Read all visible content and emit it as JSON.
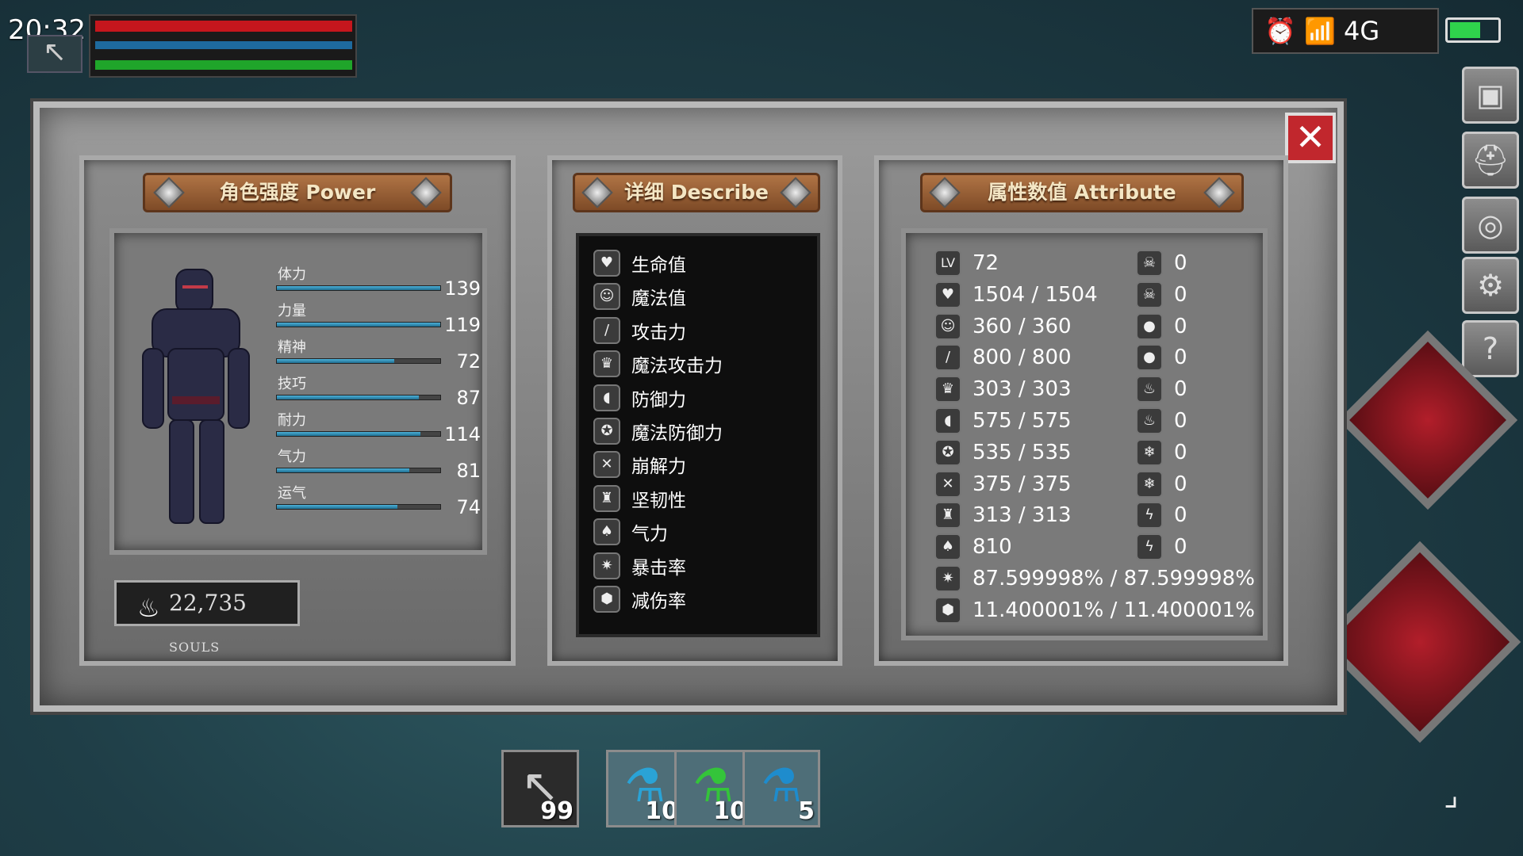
{
  "hud": {
    "time": "20:32",
    "status_text": "⏰ 📶 4G"
  },
  "panel": {
    "power_title": "角色强度 Power",
    "describe_title": "详细 Describe",
    "attribute_title": "属性数值 Attribute"
  },
  "power": {
    "stats": [
      {
        "label": "体力",
        "value": "139",
        "fill": 1.0
      },
      {
        "label": "力量",
        "value": "119",
        "fill": 1.0
      },
      {
        "label": "精神",
        "value": "72",
        "fill": 0.72
      },
      {
        "label": "技巧",
        "value": "87",
        "fill": 0.87
      },
      {
        "label": "耐力",
        "value": "114",
        "fill": 0.88
      },
      {
        "label": "气力",
        "value": "81",
        "fill": 0.81
      },
      {
        "label": "运气",
        "value": "74",
        "fill": 0.74
      }
    ],
    "souls_amount": "22,735",
    "souls_unit": "SOULS"
  },
  "describe": {
    "items": [
      {
        "label": "生命值",
        "icon": "heart-icon"
      },
      {
        "label": "魔法值",
        "icon": "mind-icon"
      },
      {
        "label": "攻击力",
        "icon": "sword-icon"
      },
      {
        "label": "魔法攻击力",
        "icon": "magic-attack-icon"
      },
      {
        "label": "防御力",
        "icon": "shield-icon"
      },
      {
        "label": "魔法防御力",
        "icon": "magic-defense-icon"
      },
      {
        "label": "崩解力",
        "icon": "break-icon"
      },
      {
        "label": "坚韧性",
        "icon": "helmet-icon"
      },
      {
        "label": "气力",
        "icon": "lungs-icon"
      },
      {
        "label": "暴击率",
        "icon": "crit-icon"
      },
      {
        "label": "减伤率",
        "icon": "damage-reduction-icon"
      }
    ]
  },
  "attributes": {
    "left": [
      {
        "icon": "level-icon",
        "value": "72"
      },
      {
        "icon": "heart-icon",
        "value": "1504 / 1504"
      },
      {
        "icon": "mind-icon",
        "value": "360 / 360"
      },
      {
        "icon": "sword-icon",
        "value": "800 / 800"
      },
      {
        "icon": "magic-attack-icon",
        "value": "303 / 303"
      },
      {
        "icon": "shield-icon",
        "value": "575 / 575"
      },
      {
        "icon": "magic-defense-icon",
        "value": "535 / 535"
      },
      {
        "icon": "break-icon",
        "value": "375 / 375"
      },
      {
        "icon": "helmet-icon",
        "value": "313 / 313"
      },
      {
        "icon": "lungs-icon",
        "value": "810"
      },
      {
        "icon": "crit-icon",
        "value": "87.599998% / 87.599998%"
      },
      {
        "icon": "damage-reduction-icon",
        "value": "11.400001% / 11.400001%"
      }
    ],
    "right": [
      {
        "icon": "poison-icon",
        "value": "0"
      },
      {
        "icon": "poison-resist-icon",
        "value": "0"
      },
      {
        "icon": "bleed-icon",
        "value": "0"
      },
      {
        "icon": "bleed-resist-icon",
        "value": "0"
      },
      {
        "icon": "fire-icon",
        "value": "0"
      },
      {
        "icon": "fire-resist-icon",
        "value": "0"
      },
      {
        "icon": "frost-icon",
        "value": "0"
      },
      {
        "icon": "frost-resist-icon",
        "value": "0"
      },
      {
        "icon": "lightning-icon",
        "value": "0"
      },
      {
        "icon": "lightning-resist-icon",
        "value": "0"
      }
    ],
    "level_glyph": "LV"
  },
  "hotbar": [
    {
      "item": "arrow",
      "count": "99"
    },
    {
      "item": "blue-potion",
      "count": "10"
    },
    {
      "item": "green-potion",
      "count": "10"
    },
    {
      "item": "blue-flask",
      "count": "5"
    }
  ],
  "colors": {
    "health": "#c5161d",
    "mana": "#1e6a9e",
    "stamina": "#1fa52a",
    "stat_bar": "#2b8bb5",
    "banner": "#9a5f35",
    "close": "#c1272d"
  }
}
